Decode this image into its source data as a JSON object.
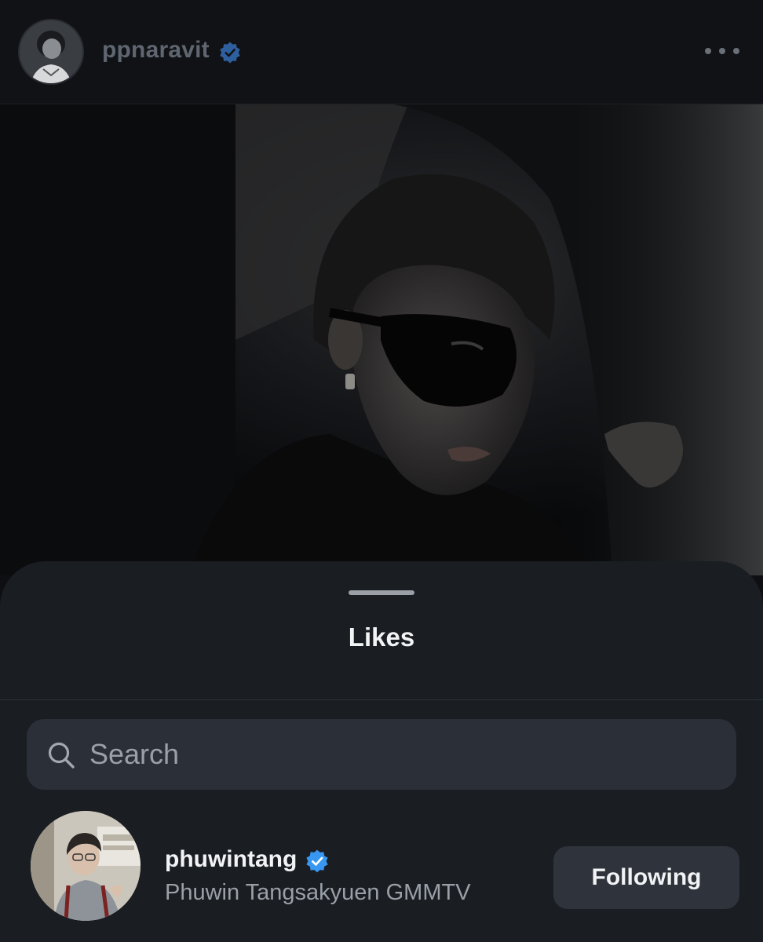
{
  "post_header": {
    "username": "ppnaravit",
    "verified_icon": "verified-badge-icon",
    "more_icon": "more-horizontal-icon"
  },
  "likes_sheet": {
    "title": "Likes",
    "search": {
      "placeholder": "Search",
      "value": "",
      "icon": "search-icon"
    },
    "users": [
      {
        "username": "phuwintang",
        "verified": true,
        "full_name": "Phuwin Tangsakyuen GMMTV",
        "button_label": "Following"
      }
    ]
  },
  "colors": {
    "background": "#0d0f13",
    "sheet": "#1a1d22",
    "search_field": "#2b2f37",
    "button": "#2f333b",
    "verified_blue": "#3897f0",
    "muted_text": "#9aa0a8",
    "primary_text": "#f2f3f5"
  }
}
